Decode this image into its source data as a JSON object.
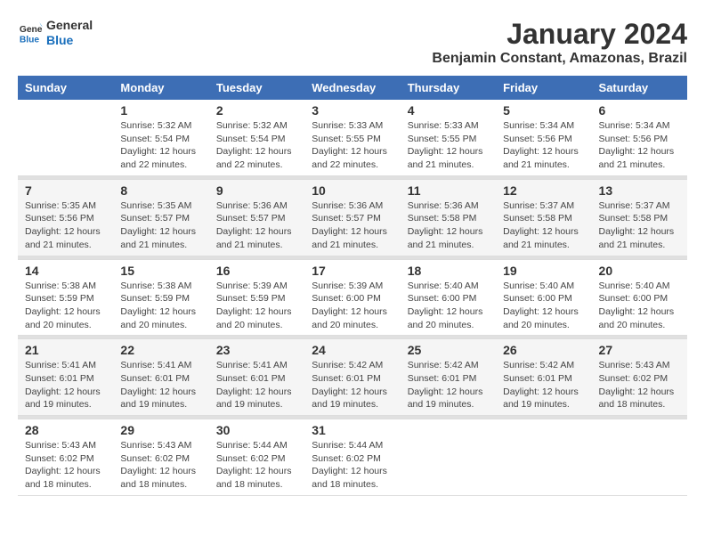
{
  "logo": {
    "line1": "General",
    "line2": "Blue"
  },
  "title": "January 2024",
  "subtitle": "Benjamin Constant, Amazonas, Brazil",
  "weekdays": [
    "Sunday",
    "Monday",
    "Tuesday",
    "Wednesday",
    "Thursday",
    "Friday",
    "Saturday"
  ],
  "weeks": [
    [
      {
        "day": "",
        "info": ""
      },
      {
        "day": "1",
        "info": "Sunrise: 5:32 AM\nSunset: 5:54 PM\nDaylight: 12 hours and 22 minutes."
      },
      {
        "day": "2",
        "info": "Sunrise: 5:32 AM\nSunset: 5:54 PM\nDaylight: 12 hours and 22 minutes."
      },
      {
        "day": "3",
        "info": "Sunrise: 5:33 AM\nSunset: 5:55 PM\nDaylight: 12 hours and 22 minutes."
      },
      {
        "day": "4",
        "info": "Sunrise: 5:33 AM\nSunset: 5:55 PM\nDaylight: 12 hours and 21 minutes."
      },
      {
        "day": "5",
        "info": "Sunrise: 5:34 AM\nSunset: 5:56 PM\nDaylight: 12 hours and 21 minutes."
      },
      {
        "day": "6",
        "info": "Sunrise: 5:34 AM\nSunset: 5:56 PM\nDaylight: 12 hours and 21 minutes."
      }
    ],
    [
      {
        "day": "7",
        "info": "Sunrise: 5:35 AM\nSunset: 5:56 PM\nDaylight: 12 hours and 21 minutes."
      },
      {
        "day": "8",
        "info": "Sunrise: 5:35 AM\nSunset: 5:57 PM\nDaylight: 12 hours and 21 minutes."
      },
      {
        "day": "9",
        "info": "Sunrise: 5:36 AM\nSunset: 5:57 PM\nDaylight: 12 hours and 21 minutes."
      },
      {
        "day": "10",
        "info": "Sunrise: 5:36 AM\nSunset: 5:57 PM\nDaylight: 12 hours and 21 minutes."
      },
      {
        "day": "11",
        "info": "Sunrise: 5:36 AM\nSunset: 5:58 PM\nDaylight: 12 hours and 21 minutes."
      },
      {
        "day": "12",
        "info": "Sunrise: 5:37 AM\nSunset: 5:58 PM\nDaylight: 12 hours and 21 minutes."
      },
      {
        "day": "13",
        "info": "Sunrise: 5:37 AM\nSunset: 5:58 PM\nDaylight: 12 hours and 21 minutes."
      }
    ],
    [
      {
        "day": "14",
        "info": "Sunrise: 5:38 AM\nSunset: 5:59 PM\nDaylight: 12 hours and 20 minutes."
      },
      {
        "day": "15",
        "info": "Sunrise: 5:38 AM\nSunset: 5:59 PM\nDaylight: 12 hours and 20 minutes."
      },
      {
        "day": "16",
        "info": "Sunrise: 5:39 AM\nSunset: 5:59 PM\nDaylight: 12 hours and 20 minutes."
      },
      {
        "day": "17",
        "info": "Sunrise: 5:39 AM\nSunset: 6:00 PM\nDaylight: 12 hours and 20 minutes."
      },
      {
        "day": "18",
        "info": "Sunrise: 5:40 AM\nSunset: 6:00 PM\nDaylight: 12 hours and 20 minutes."
      },
      {
        "day": "19",
        "info": "Sunrise: 5:40 AM\nSunset: 6:00 PM\nDaylight: 12 hours and 20 minutes."
      },
      {
        "day": "20",
        "info": "Sunrise: 5:40 AM\nSunset: 6:00 PM\nDaylight: 12 hours and 20 minutes."
      }
    ],
    [
      {
        "day": "21",
        "info": "Sunrise: 5:41 AM\nSunset: 6:01 PM\nDaylight: 12 hours and 19 minutes."
      },
      {
        "day": "22",
        "info": "Sunrise: 5:41 AM\nSunset: 6:01 PM\nDaylight: 12 hours and 19 minutes."
      },
      {
        "day": "23",
        "info": "Sunrise: 5:41 AM\nSunset: 6:01 PM\nDaylight: 12 hours and 19 minutes."
      },
      {
        "day": "24",
        "info": "Sunrise: 5:42 AM\nSunset: 6:01 PM\nDaylight: 12 hours and 19 minutes."
      },
      {
        "day": "25",
        "info": "Sunrise: 5:42 AM\nSunset: 6:01 PM\nDaylight: 12 hours and 19 minutes."
      },
      {
        "day": "26",
        "info": "Sunrise: 5:42 AM\nSunset: 6:01 PM\nDaylight: 12 hours and 19 minutes."
      },
      {
        "day": "27",
        "info": "Sunrise: 5:43 AM\nSunset: 6:02 PM\nDaylight: 12 hours and 18 minutes."
      }
    ],
    [
      {
        "day": "28",
        "info": "Sunrise: 5:43 AM\nSunset: 6:02 PM\nDaylight: 12 hours and 18 minutes."
      },
      {
        "day": "29",
        "info": "Sunrise: 5:43 AM\nSunset: 6:02 PM\nDaylight: 12 hours and 18 minutes."
      },
      {
        "day": "30",
        "info": "Sunrise: 5:44 AM\nSunset: 6:02 PM\nDaylight: 12 hours and 18 minutes."
      },
      {
        "day": "31",
        "info": "Sunrise: 5:44 AM\nSunset: 6:02 PM\nDaylight: 12 hours and 18 minutes."
      },
      {
        "day": "",
        "info": ""
      },
      {
        "day": "",
        "info": ""
      },
      {
        "day": "",
        "info": ""
      }
    ]
  ]
}
